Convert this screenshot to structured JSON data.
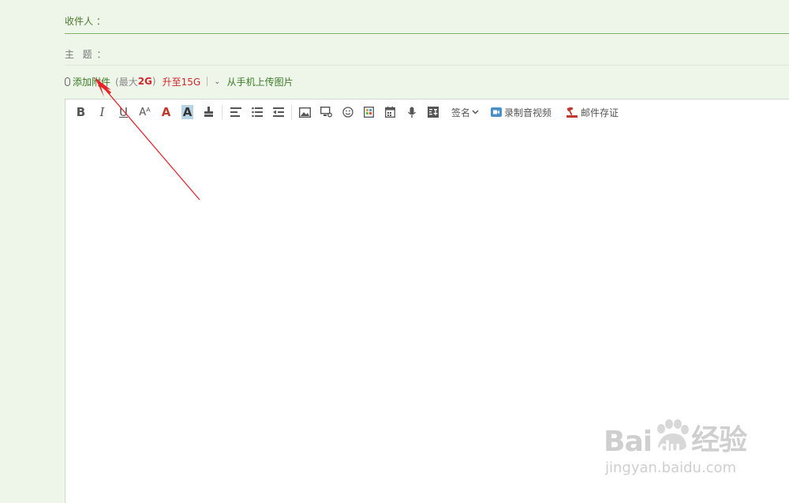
{
  "to": {
    "label": "收件人 ：",
    "value": ""
  },
  "subject": {
    "label": "主  题 ：",
    "value": ""
  },
  "attach": {
    "add_label": "添加附件",
    "max_prefix": "(最大",
    "max_value": "2G",
    "max_suffix": ")",
    "upgrade_label": "升至15G",
    "mobile_label": "从手机上传图片"
  },
  "toolbar": {
    "bold": "B",
    "italic": "I",
    "underline": "U",
    "font_size": "Aᴬ",
    "font_color": "A",
    "bg_color": "A",
    "signature_label": "签名",
    "record_video_label": "录制音视频",
    "mail_evidence_label": "邮件存证"
  },
  "editor": {
    "content": ""
  },
  "watermark": {
    "brand_left": "Bai",
    "brand_mid": "du",
    "brand_right": "经验",
    "url": "jingyan.baidu.com"
  },
  "colors": {
    "background": "#eef6ea",
    "label_green": "#3b7b25",
    "accent_red": "#d1272b",
    "arrow": "#e8232a"
  }
}
